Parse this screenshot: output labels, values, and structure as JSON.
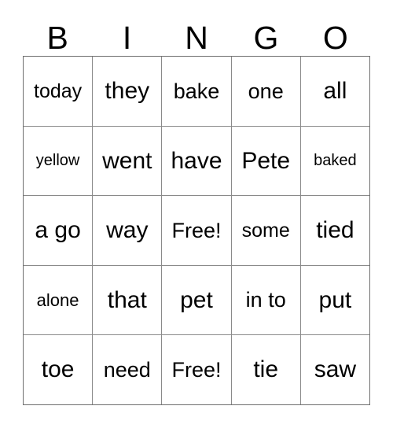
{
  "card": {
    "title": "BINGO",
    "free_space_label": "Free!"
  },
  "header": {
    "letters": [
      "B",
      "I",
      "N",
      "G",
      "O"
    ]
  },
  "grid": {
    "columns": 5,
    "rows": 5,
    "cells": [
      [
        {
          "text": "today",
          "size": "fs-m",
          "free": false
        },
        {
          "text": "they",
          "size": "fs-xl",
          "free": false
        },
        {
          "text": "bake",
          "size": "fs-l",
          "free": false
        },
        {
          "text": "one",
          "size": "fs-l",
          "free": false
        },
        {
          "text": "all",
          "size": "fs-xl",
          "free": false
        }
      ],
      [
        {
          "text": "yellow",
          "size": "fs-xs",
          "free": false
        },
        {
          "text": "went",
          "size": "fs-xl",
          "free": false
        },
        {
          "text": "have",
          "size": "fs-xl",
          "free": false
        },
        {
          "text": "Pete",
          "size": "fs-xl",
          "free": false
        },
        {
          "text": "baked",
          "size": "fs-xs",
          "free": false
        }
      ],
      [
        {
          "text": "a go",
          "size": "fs-xl",
          "free": false
        },
        {
          "text": "way",
          "size": "fs-xl",
          "free": false
        },
        {
          "text": "Free!",
          "size": "fs-l",
          "free": true
        },
        {
          "text": "some",
          "size": "fs-m",
          "free": false
        },
        {
          "text": "tied",
          "size": "fs-xl",
          "free": false
        }
      ],
      [
        {
          "text": "alone",
          "size": "fs-s",
          "free": false
        },
        {
          "text": "that",
          "size": "fs-xl",
          "free": false
        },
        {
          "text": "pet",
          "size": "fs-xl",
          "free": false
        },
        {
          "text": "in to",
          "size": "fs-l",
          "free": false
        },
        {
          "text": "put",
          "size": "fs-xl",
          "free": false
        }
      ],
      [
        {
          "text": "toe",
          "size": "fs-xl",
          "free": false
        },
        {
          "text": "need",
          "size": "fs-l",
          "free": false
        },
        {
          "text": "Free!",
          "size": "fs-l",
          "free": true
        },
        {
          "text": "tie",
          "size": "fs-xl",
          "free": false
        },
        {
          "text": "saw",
          "size": "fs-xl",
          "free": false
        }
      ]
    ]
  },
  "colors": {
    "background": "#ffffff",
    "text": "#000000",
    "grid_line": "#8a8a8a",
    "grid_frame": "#6e6e6e"
  }
}
